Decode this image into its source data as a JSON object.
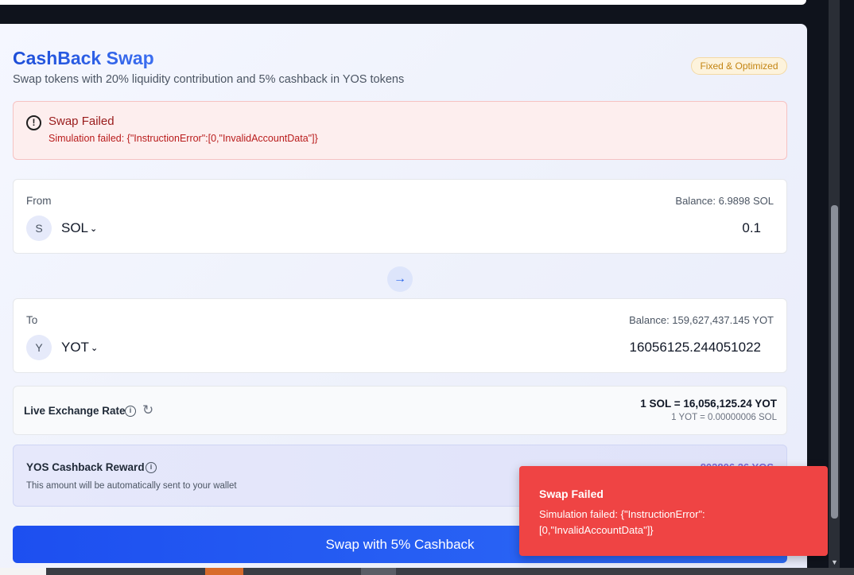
{
  "header": {
    "title": "CashBack Swap",
    "subtitle": "Swap tokens with 20% liquidity contribution and 5% cashback in YOS tokens",
    "badge": "Fixed & Optimized"
  },
  "error": {
    "icon": "alert-circle-icon",
    "title": "Swap Failed",
    "message": "Simulation failed: {\"InstructionError\":[0,\"InvalidAccountData\"]}"
  },
  "from": {
    "label": "From",
    "balance": "Balance: 6.9898 SOL",
    "token_initial": "S",
    "token": "SOL",
    "amount": "0.1"
  },
  "to": {
    "label": "To",
    "balance": "Balance: 159,627,437.145 YOT",
    "token_initial": "Y",
    "token": "YOT",
    "amount": "16056125.244051022"
  },
  "rate": {
    "label": "Live Exchange Rate",
    "main": "1 SOL = 16,056,125.24 YOT",
    "inverse": "1 YOT = 0.00000006 SOL"
  },
  "cashback": {
    "title": "YOS Cashback Reward",
    "subtitle": "This amount will be automatically sent to your wallet",
    "amount": "802806.26 YOS"
  },
  "swap_button": {
    "label": "Swap with 5% Cashback"
  },
  "toast": {
    "title": "Swap Failed",
    "message": "Simulation failed: {\"InstructionError\":[0,\"InvalidAccountData\"]}"
  },
  "colors": {
    "accent": "#2563eb",
    "error": "#ef4444",
    "badge": "#c38412"
  }
}
